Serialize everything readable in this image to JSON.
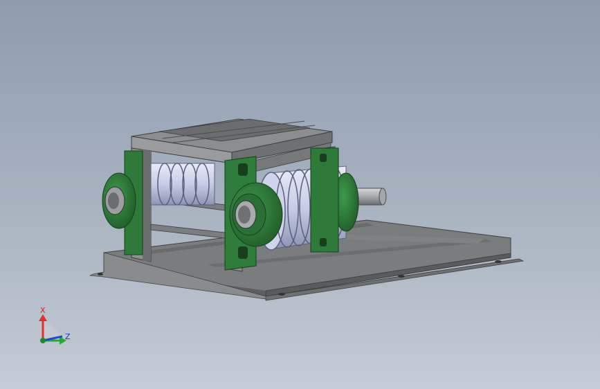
{
  "viewport": {
    "background_top": "#8d9cae",
    "background_bottom": "#c4ccd5",
    "model": "roller-conveyor-assembly"
  },
  "colors": {
    "steel_frame": "#8f9090",
    "steel_dark": "#5c5d5e",
    "bearing_green": "#2e7d3a",
    "roller_blue": "#c9cfe6",
    "shaft": "#a7a9ab"
  },
  "triad": {
    "x_label": "X",
    "z_label": "Z",
    "x_color": "#e03030",
    "y_color": "#22aa33",
    "z_color": "#2244dd"
  }
}
